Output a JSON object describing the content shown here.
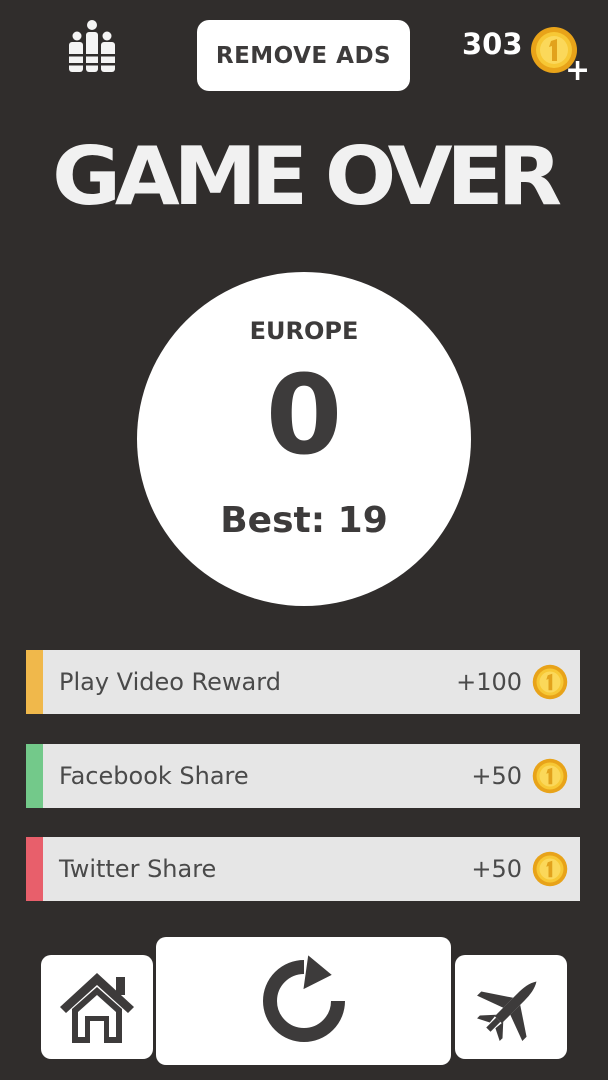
{
  "header": {
    "leaderboard_icon": "leaderboard-icon",
    "remove_ads_label": "REMOVE ADS",
    "coin_count": "303",
    "coin_icon": "coin-icon",
    "add_coins_label": "+"
  },
  "title": "GAME OVER",
  "score_panel": {
    "level_name": "EUROPE",
    "score": "0",
    "best": "Best: 19"
  },
  "rewards": [
    {
      "label": "Play Video Reward",
      "amount": "+100",
      "accent": "#f0b84b"
    },
    {
      "label": "Facebook Share",
      "amount": "+50",
      "accent": "#73c98a"
    },
    {
      "label": "Twitter Share",
      "amount": "+50",
      "accent": "#e85f6b"
    }
  ],
  "bottom_nav": {
    "home_icon": "home-icon",
    "restart_icon": "restart-icon",
    "plane_select_icon": "fighter-jet-icon"
  },
  "colors": {
    "background": "#302d2c",
    "panel": "#ffffff",
    "text_dark": "#3d3b3b",
    "row_bg": "#e6e6e6",
    "coin_gold": "#f5c030"
  }
}
